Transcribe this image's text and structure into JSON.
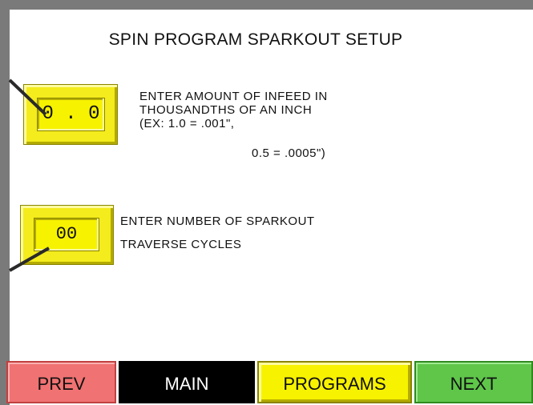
{
  "title": "SPIN PROGRAM SPARKOUT SETUP",
  "infeed": {
    "value": "0.0",
    "description_lines": [
      "ENTER AMOUNT OF INFEED IN",
      "THOUSANDTHS OF AN INCH",
      "(EX: 1.0 = .001\",",
      "0.5 = .0005\")"
    ]
  },
  "sparkout": {
    "value": "00",
    "description_lines": [
      "ENTER NUMBER OF SPARKOUT",
      "TRAVERSE CYCLES"
    ]
  },
  "nav": {
    "prev": "PREV",
    "main": "MAIN",
    "programs": "PROGRAMS",
    "next": "NEXT"
  },
  "colors": {
    "frame": "#7a7a7a",
    "screen": "#ffffff",
    "input_yellow": "#f7f200",
    "prev_red": "#f07272",
    "main_black": "#000000",
    "next_green": "#5fc64a"
  }
}
